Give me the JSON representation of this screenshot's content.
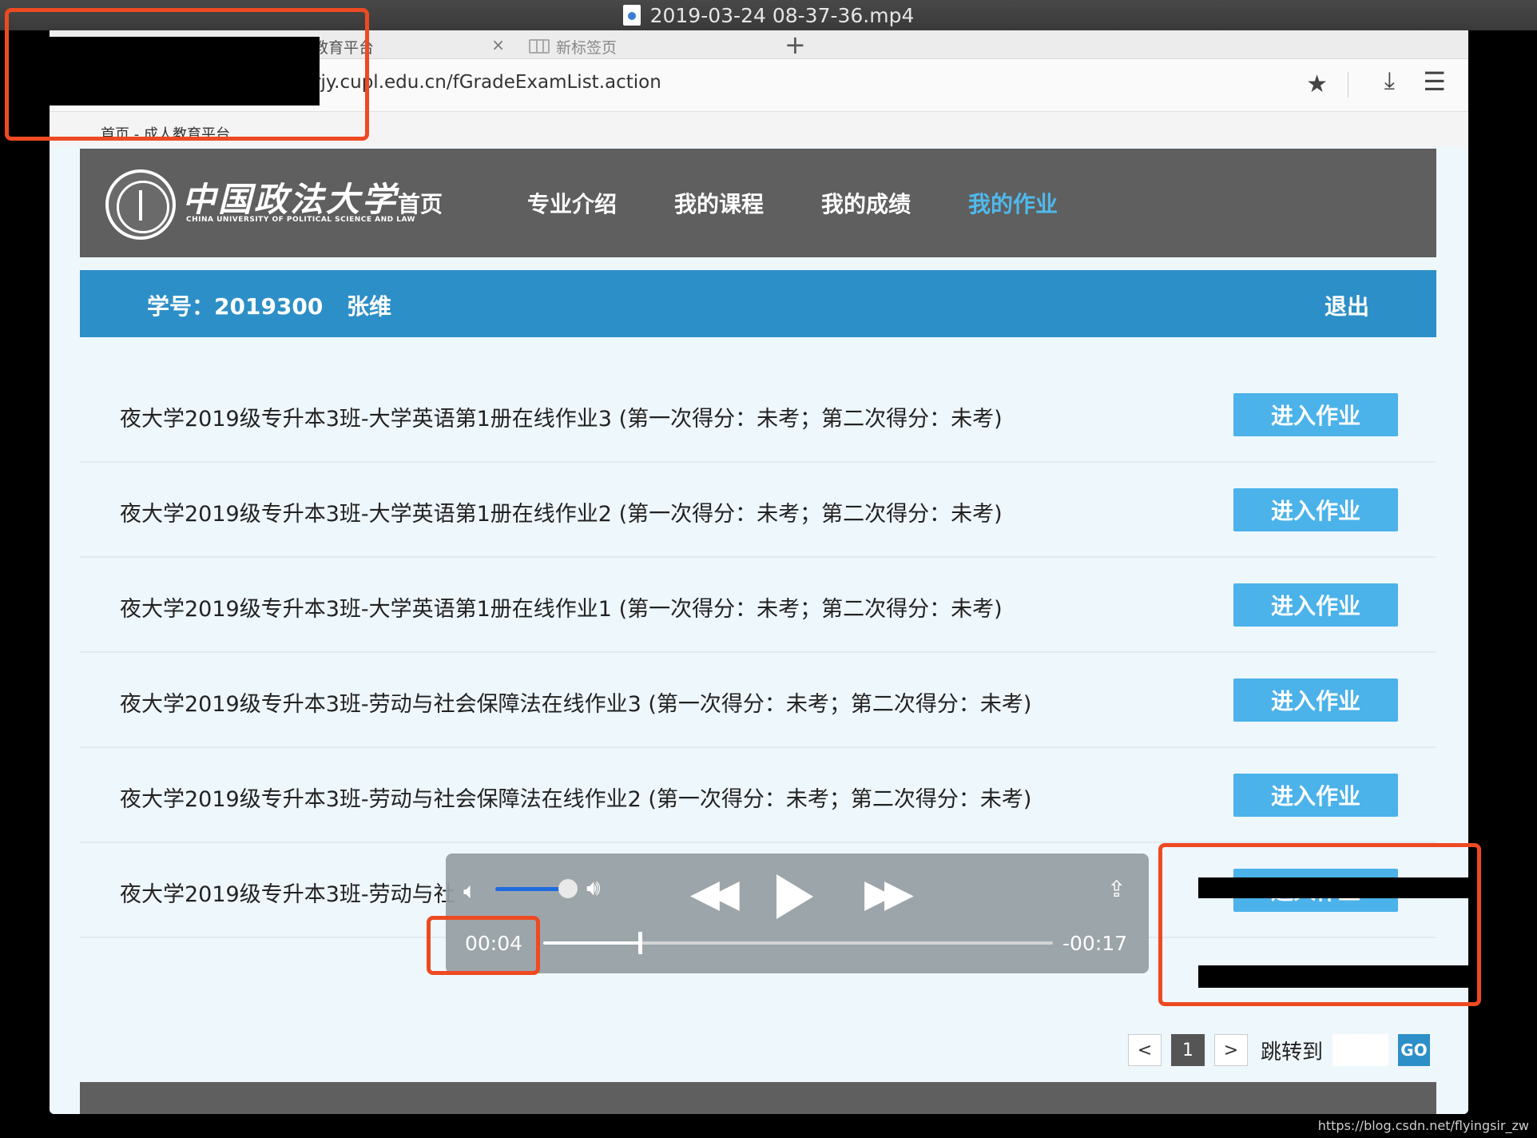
{
  "player": {
    "title": "2019-03-24 08-37-36.mp4",
    "elapsed": "00:04",
    "remaining": "-00:17",
    "volume_level": 0.85,
    "progress": 0.19
  },
  "browser": {
    "tabs": [
      {
        "label": "教育平台",
        "close": "×"
      },
      {
        "label": "新标签页"
      }
    ],
    "new_tab": "+",
    "url": "rjy.cupl.edu.cn/fGradeExamList.action",
    "bookmark": "首页 - 成人教育平台"
  },
  "site": {
    "logo": "中国政法大学",
    "logo_sub": "CHINA UNIVERSITY OF POLITICAL SCIENCE AND LAW",
    "nav": [
      "首页",
      "专业介绍",
      "我的课程",
      "我的成绩",
      "我的作业"
    ],
    "active_nav": "我的作业",
    "student_id_label": "学号：2019300",
    "student_name": "张维",
    "logout": "退出",
    "accent": "#4bb2ea",
    "bar_color": "#2d8fc7"
  },
  "assignments": [
    {
      "title": "夜大学2019级专升本3班-大学英语第1册在线作业3 (第一次得分：未考；第二次得分：未考)",
      "button": "进入作业"
    },
    {
      "title": "夜大学2019级专升本3班-大学英语第1册在线作业2 (第一次得分：未考；第二次得分：未考)",
      "button": "进入作业"
    },
    {
      "title": "夜大学2019级专升本3班-大学英语第1册在线作业1 (第一次得分：未考；第二次得分：未考)",
      "button": "进入作业"
    },
    {
      "title": "夜大学2019级专升本3班-劳动与社会保障法在线作业3 (第一次得分：未考；第二次得分：未考)",
      "button": "进入作业"
    },
    {
      "title": "夜大学2019级专升本3班-劳动与社会保障法在线作业2 (第一次得分：未考；第二次得分：未考)",
      "button": "进入作业"
    },
    {
      "title": "夜大学2019级专升本3班-劳动与社",
      "button": "进入作业"
    }
  ],
  "pagination": {
    "prev": "<",
    "current": "1",
    "next": ">",
    "jump_label": "跳转到",
    "go": "GO"
  },
  "watermark": "https://blog.csdn.net/flyingsir_zw"
}
